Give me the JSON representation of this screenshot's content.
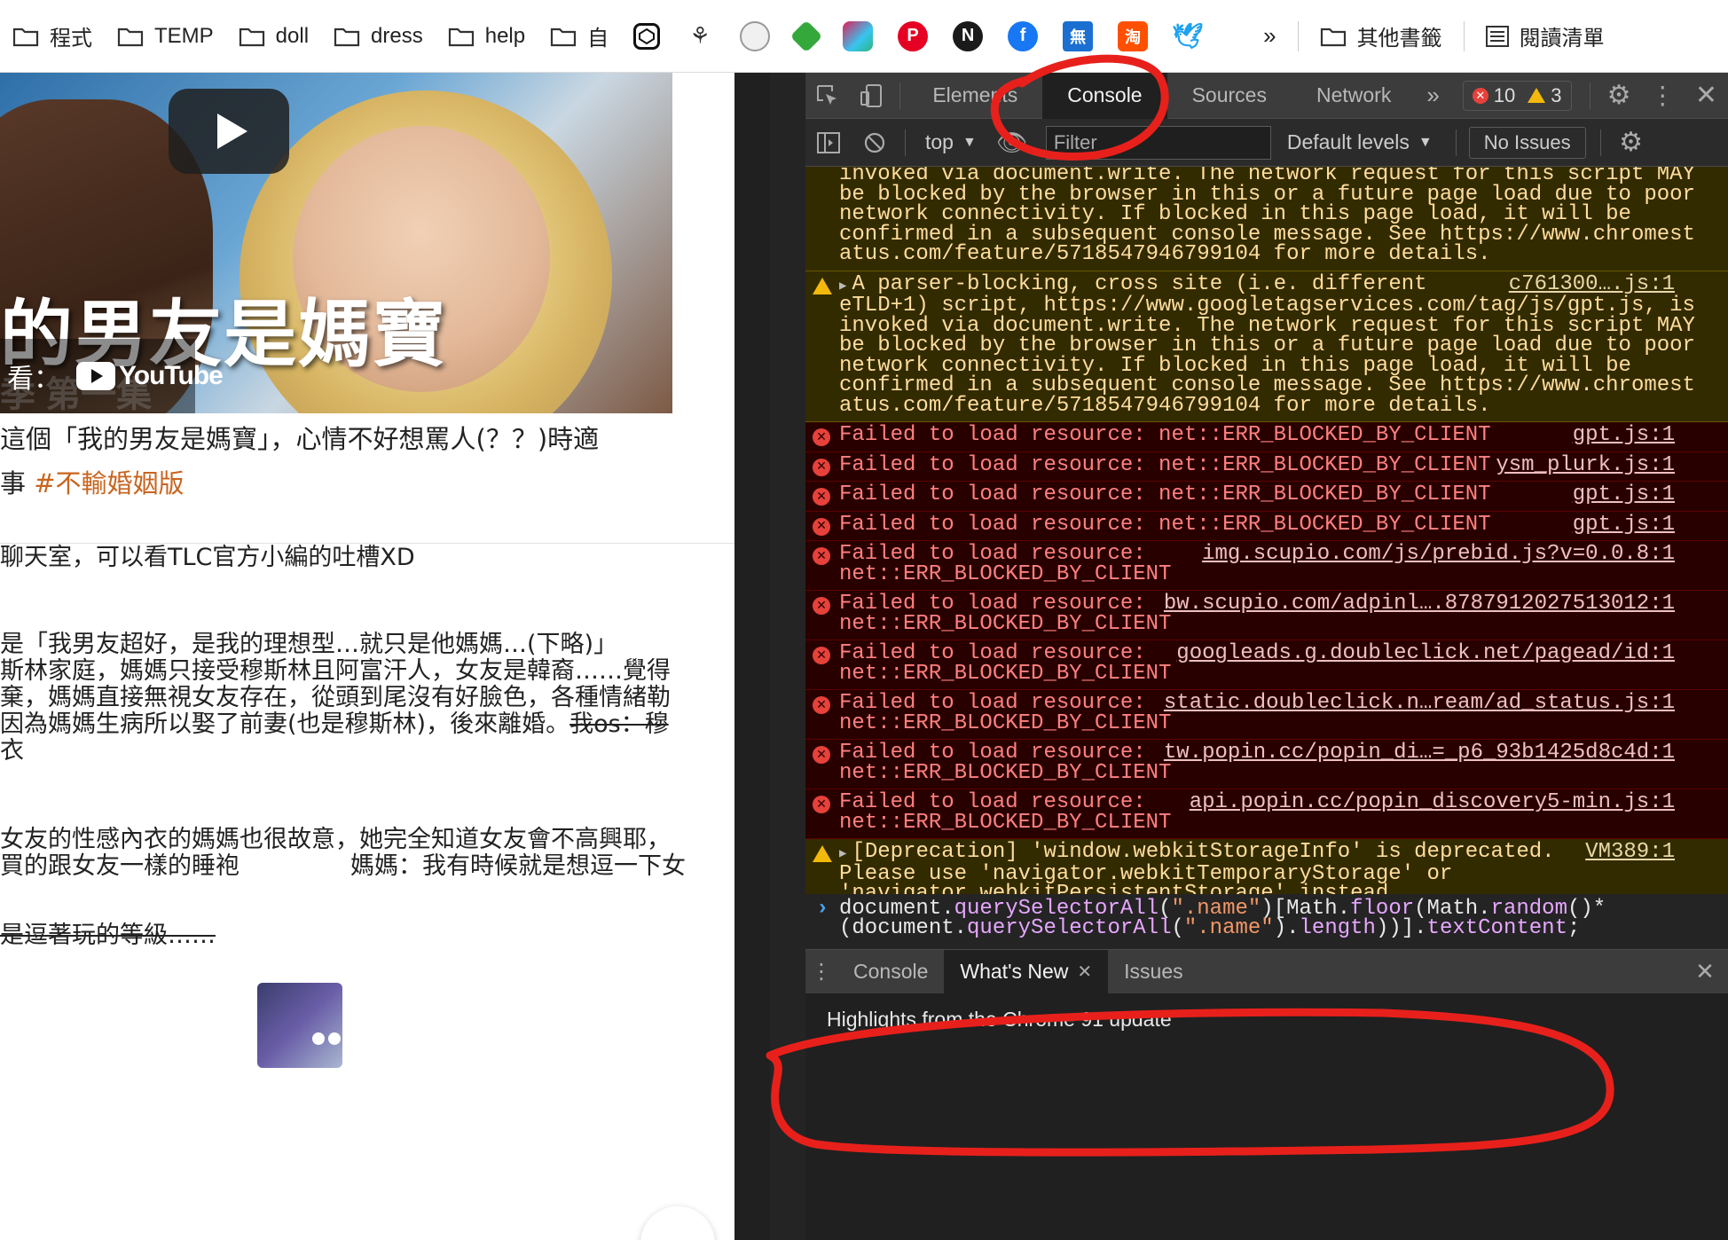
{
  "bookmarks": {
    "items": [
      {
        "type": "folder",
        "label": "程式"
      },
      {
        "type": "folder",
        "label": "TEMP"
      },
      {
        "type": "folder",
        "label": "doll"
      },
      {
        "type": "folder",
        "label": "dress"
      },
      {
        "type": "folder",
        "label": "help"
      },
      {
        "type": "folder",
        "label": "自"
      }
    ],
    "overflow": "»",
    "other_bookmarks": "其他書籤",
    "reading_list": "閱讀清單"
  },
  "webpage": {
    "video_title": "的男友是媽寶",
    "video_prefix": "看：",
    "video_logo": "YouTube",
    "video_sub": "季 第一集",
    "caption": "這個「我的男友是媽寶」，心情不好想罵人(？？)時適",
    "tag_prefix": "事 ",
    "tag": "#不輸婚姻版",
    "paragraphs": [
      "聊天室，可以看TLC官方小編的吐槽XD",
      "是「我男友超好，是我的理想型…就只是他媽媽…(下略)」",
      "斯林家庭，媽媽只接受穆斯林且阿富汗人，女友是韓裔……覺得",
      "棄，媽媽直接無視女友存在，從頭到尾沒有好臉色，各種情緒勒",
      "因為媽媽生病所以娶了前妻(也是穆斯林)，後來離婚。",
      "衣",
      "女友的性感內衣的媽媽也很故意，她完全知道女友會不高興耶，",
      "買的跟女友一樣的睡袍",
      "媽媽：我有時候就是想逗一下女",
      "是逗著玩的等級……"
    ],
    "strike_text": "我os：穆"
  },
  "devtools": {
    "tabs": [
      "Elements",
      "Console",
      "Sources",
      "Network"
    ],
    "active_tab": "Console",
    "more_tabs": "»",
    "error_count": "10",
    "warning_count": "3",
    "context": "top",
    "filter_placeholder": "Filter",
    "levels": "Default levels",
    "issues": "No Issues",
    "messages": [
      {
        "level": "warn",
        "continued": true,
        "lines": [
          "invoked via document.write. The network request for this script MAY",
          "be blocked by the browser in this or a future page load due to poor",
          "network connectivity. If blocked in this page load, it will be",
          "confirmed in a subsequent console message. See https://www.chromest",
          "atus.com/feature/5718547946799104 for more details."
        ]
      },
      {
        "level": "warn",
        "source": "c761300….js:1",
        "lines": [
          "A parser-blocking, cross site (i.e. different",
          "eTLD+1) script, https://www.googletagservices.com/tag/js/gpt.js, is",
          "invoked via document.write. The network request for this script MAY",
          "be blocked by the browser in this or a future page load due to poor",
          "network connectivity. If blocked in this page load, it will be",
          "confirmed in a subsequent console message. See https://www.chromest",
          "atus.com/feature/5718547946799104 for more details."
        ]
      },
      {
        "level": "error",
        "source": "gpt.js:1",
        "lines": [
          "Failed to load resource: net::ERR_BLOCKED_BY_CLIENT"
        ]
      },
      {
        "level": "error",
        "source": "ysm_plurk.js:1",
        "lines": [
          "Failed to load resource: net::ERR_BLOCKED_BY_CLIENT"
        ]
      },
      {
        "level": "error",
        "source": "gpt.js:1",
        "lines": [
          "Failed to load resource: net::ERR_BLOCKED_BY_CLIENT"
        ]
      },
      {
        "level": "error",
        "source": "gpt.js:1",
        "lines": [
          "Failed to load resource: net::ERR_BLOCKED_BY_CLIENT"
        ]
      },
      {
        "level": "error",
        "source": "img.scupio.com/js/prebid.js?v=0.0.8:1",
        "lines": [
          "Failed to load resource:",
          "net::ERR_BLOCKED_BY_CLIENT"
        ]
      },
      {
        "level": "error",
        "source": "bw.scupio.com/adpinl….8787912027513012:1",
        "lines": [
          "Failed to load resource:",
          "net::ERR_BLOCKED_BY_CLIENT"
        ]
      },
      {
        "level": "error",
        "source": "googleads.g.doubleclick.net/pagead/id:1",
        "lines": [
          "Failed to load resource:",
          "net::ERR_BLOCKED_BY_CLIENT"
        ]
      },
      {
        "level": "error",
        "source": "static.doubleclick.n…ream/ad_status.js:1",
        "lines": [
          "Failed to load resource:",
          "net::ERR_BLOCKED_BY_CLIENT"
        ]
      },
      {
        "level": "error",
        "source": "tw.popin.cc/popin_di…=_p6_93b1425d8c4d:1",
        "lines": [
          "Failed to load resource:",
          "net::ERR_BLOCKED_BY_CLIENT"
        ]
      },
      {
        "level": "error",
        "source": "api.popin.cc/popin_discovery5-min.js:1",
        "lines": [
          "Failed to load resource:",
          "net::ERR_BLOCKED_BY_CLIENT"
        ]
      },
      {
        "level": "warn",
        "source": "VM389:1",
        "expandable": true,
        "lines": [
          "[Deprecation] 'window.webkitStorageInfo' is deprecated.",
          "Please use 'navigator.webkitTemporaryStorage' or",
          "'navigator.webkitPersistentStorage' instead."
        ]
      }
    ],
    "prompt_line1": "document.querySelectorAll(\".name\")[Math.floor(Math.random()*",
    "prompt_line2": "(document.querySelectorAll(\".name\").length))].textContent;",
    "drawer_tabs": [
      "Console",
      "What's New",
      "Issues"
    ],
    "drawer_active": "What's New",
    "drawer_text": "Highlights from the Chrome 91 update"
  },
  "colors": {
    "annotation": "#e8201b",
    "devtools_bg": "#242424",
    "warn_bg": "#332b00",
    "error_bg": "#290000"
  }
}
